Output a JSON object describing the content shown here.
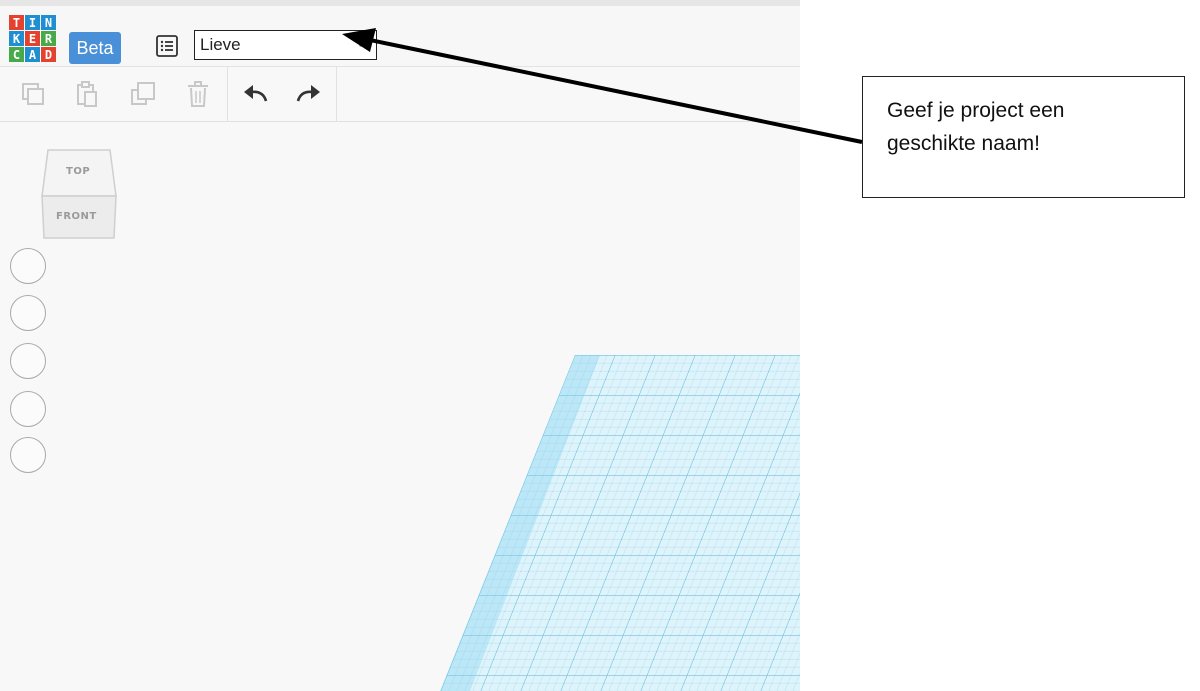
{
  "app": {
    "logo_letters": [
      "T",
      "I",
      "N",
      "K",
      "E",
      "R",
      "C",
      "A",
      "D"
    ],
    "logo_colors": [
      "#e2422e",
      "#1f8fd1",
      "#1f8fd1",
      "#1f8fd1",
      "#e2422e",
      "#48a94a",
      "#48a94a",
      "#1f8fd1",
      "#e2422e"
    ],
    "beta_label": "Beta",
    "beta_color": "#4a90d9",
    "accent_grid": "#7fd2ee"
  },
  "header": {
    "design_list_icon": "list-icon",
    "project_name_value": "Lieve",
    "project_name_confirm_icon": "check-icon"
  },
  "toolbar": {
    "buttons": [
      {
        "name": "copy",
        "icon": "copy-icon",
        "enabled": false
      },
      {
        "name": "paste",
        "icon": "paste-icon",
        "enabled": false
      },
      {
        "name": "duplicate",
        "icon": "duplicate-icon",
        "enabled": false
      },
      {
        "name": "delete",
        "icon": "trash-icon",
        "enabled": false
      },
      {
        "name": "undo",
        "icon": "undo-icon",
        "enabled": true
      },
      {
        "name": "redo",
        "icon": "redo-icon",
        "enabled": true
      }
    ]
  },
  "viewcube": {
    "top_label": "TOP",
    "front_label": "FRONT"
  },
  "view_controls": {
    "count": 5,
    "items": [
      "home-view-icon",
      "fit-view-icon",
      "zoom-in-icon",
      "zoom-out-icon",
      "perspective-icon"
    ]
  },
  "annotation": {
    "callout_line1": "Geef je project een",
    "callout_line2": "geschikte naam!"
  }
}
